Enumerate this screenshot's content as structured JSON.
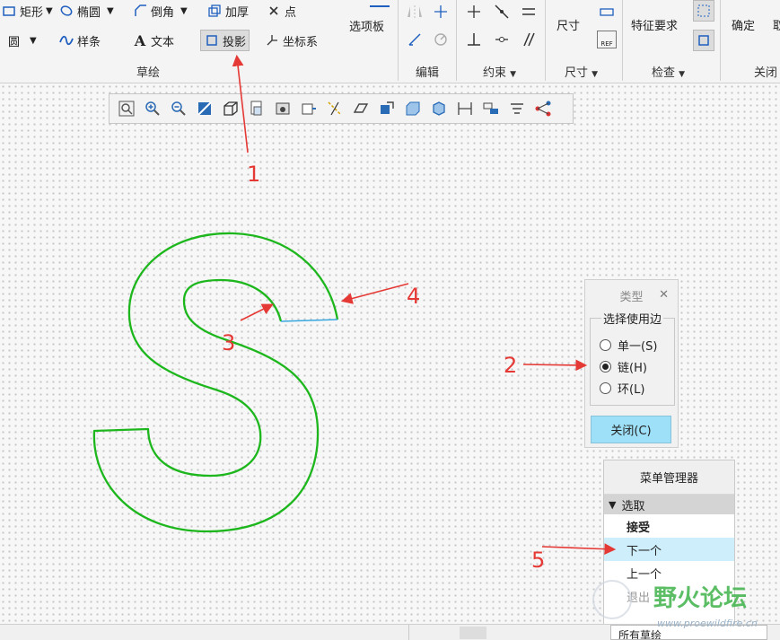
{
  "ribbon": {
    "sketch": {
      "rect_label": "矩形",
      "ellipse_label": "椭圆",
      "chamfer_label": "倒角",
      "thicken_label": "加厚",
      "point_label": "点",
      "circle_label": "圆",
      "spline_label": "样条",
      "text_label": "文本",
      "project_label": "投影",
      "csys_label": "坐标系",
      "palette_label": "选项板",
      "group_label": "草绘"
    },
    "edit_group_label": "编辑",
    "constrain_group_label": "约束",
    "dimension": {
      "label": "尺寸",
      "group_label": "尺寸",
      "ref_label": "REF"
    },
    "inspect": {
      "feature_req_label": "特征要求",
      "group_label": "检查"
    },
    "ok_label": "确定",
    "close_group_label": "关闭"
  },
  "type_dialog": {
    "title": "类型",
    "legend": "选择使用边",
    "options": [
      "单一(S)",
      "链(H)",
      "环(L)"
    ],
    "selected": "链(H)",
    "close_button": "关闭(C)"
  },
  "menu_manager": {
    "title": "菜单管理器",
    "section": "选取",
    "items": [
      "接受",
      "下一个",
      "上一个",
      "退出"
    ],
    "highlighted": "下一个"
  },
  "status_bar": {
    "filter_label": "所有草绘"
  },
  "annotations": [
    "1",
    "2",
    "3",
    "4",
    "5"
  ],
  "watermark": {
    "text": "野火论坛",
    "url": "www.proewildfire.cn"
  },
  "colors": {
    "accent": "#9ee0f7",
    "sketch_green": "#1db71d",
    "arrow_red": "#e53935"
  }
}
